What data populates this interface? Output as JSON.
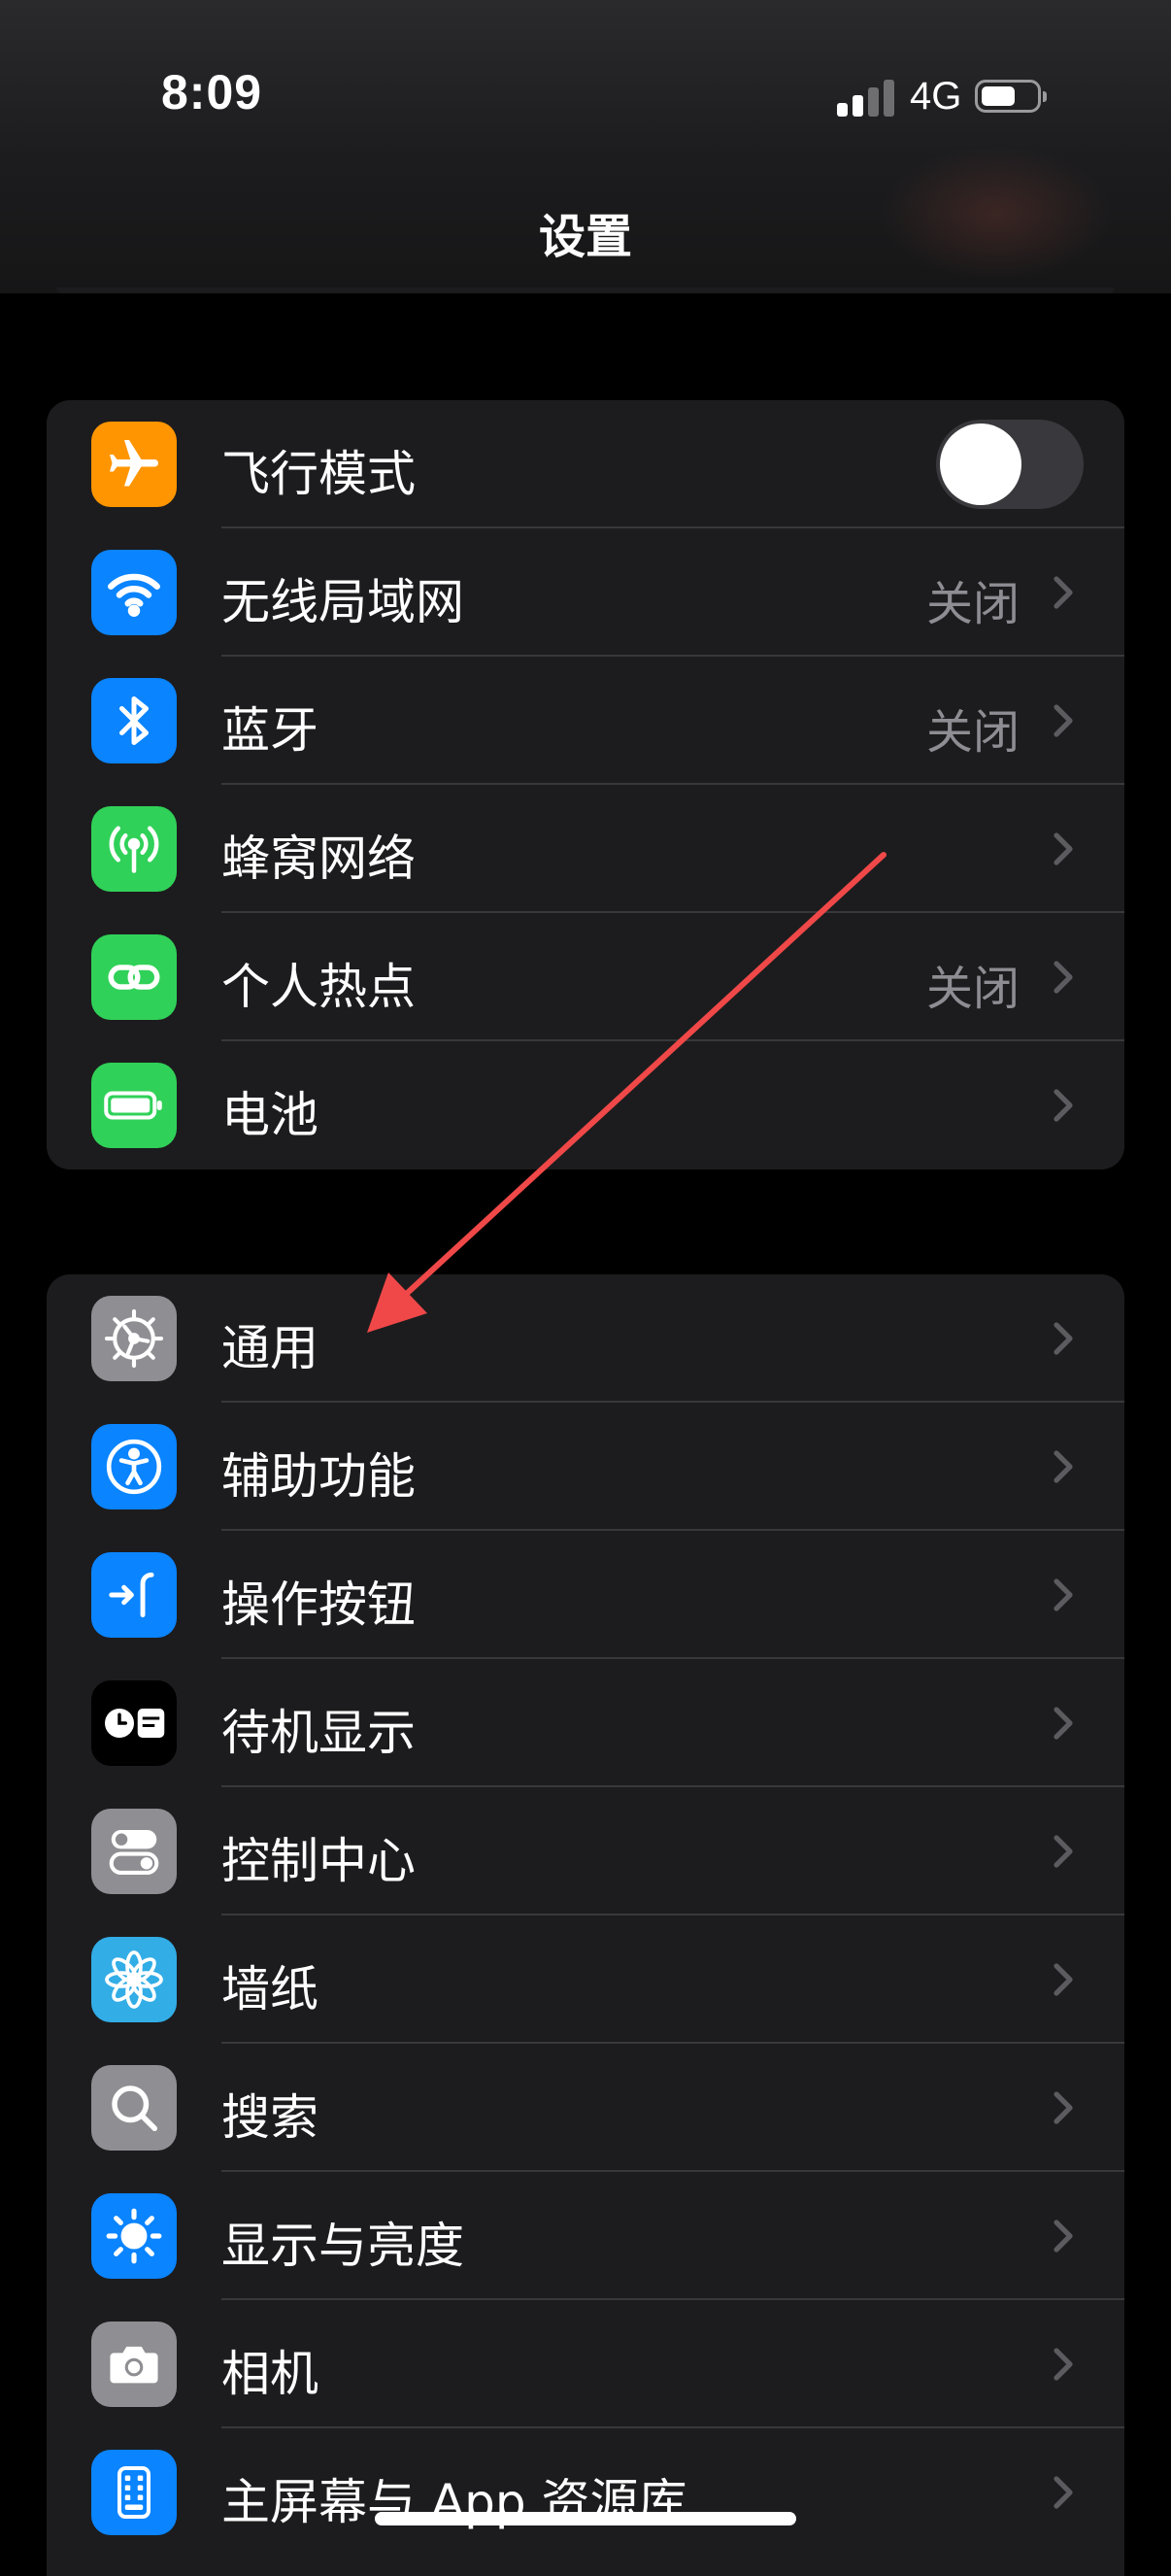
{
  "status_bar": {
    "time": "8:09",
    "network": "4G"
  },
  "header": {
    "title": "设置"
  },
  "group1": [
    {
      "id": "airplane",
      "label": "飞行模式",
      "icon": "airplane-icon",
      "color": "#ff9500",
      "toggle": false
    },
    {
      "id": "wifi",
      "label": "无线局域网",
      "value": "关闭",
      "icon": "wifi-icon",
      "color": "#0a84ff"
    },
    {
      "id": "bluetooth",
      "label": "蓝牙",
      "value": "关闭",
      "icon": "bluetooth-icon",
      "color": "#0a84ff"
    },
    {
      "id": "cellular",
      "label": "蜂窝网络",
      "icon": "antenna-icon",
      "color": "#30d158"
    },
    {
      "id": "hotspot",
      "label": "个人热点",
      "value": "关闭",
      "icon": "link-icon",
      "color": "#30d158"
    },
    {
      "id": "battery",
      "label": "电池",
      "icon": "battery-icon",
      "color": "#30d158"
    }
  ],
  "group2": [
    {
      "id": "general",
      "label": "通用",
      "icon": "gear-icon",
      "color": "#8e8e93"
    },
    {
      "id": "accessibility",
      "label": "辅助功能",
      "icon": "accessibility-icon",
      "color": "#0a84ff"
    },
    {
      "id": "action-button",
      "label": "操作按钮",
      "icon": "action-button-icon",
      "color": "#0a84ff"
    },
    {
      "id": "standby",
      "label": "待机显示",
      "icon": "standby-icon",
      "color": "#000000"
    },
    {
      "id": "control-center",
      "label": "控制中心",
      "icon": "switches-icon",
      "color": "#8e8e93"
    },
    {
      "id": "wallpaper",
      "label": "墙纸",
      "icon": "flower-icon",
      "color": "#32ade6"
    },
    {
      "id": "search",
      "label": "搜索",
      "icon": "search-icon",
      "color": "#8e8e93"
    },
    {
      "id": "display",
      "label": "显示与亮度",
      "icon": "sun-icon",
      "color": "#0a84ff"
    },
    {
      "id": "camera",
      "label": "相机",
      "icon": "camera-icon",
      "color": "#8e8e93"
    },
    {
      "id": "home-screen",
      "label": "主屏幕与 App 资源库",
      "icon": "home-screen-icon",
      "color": "#0a84ff"
    }
  ],
  "annotation": {
    "color": "#f04848"
  }
}
